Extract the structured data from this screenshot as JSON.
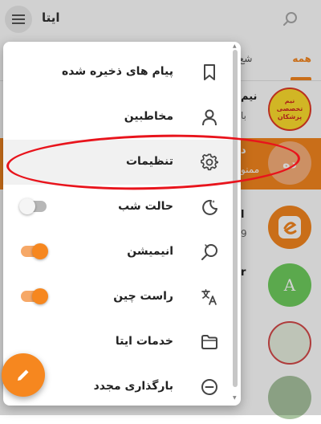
{
  "app": {
    "title": "ایتا"
  },
  "tabs": [
    {
      "label": "همه",
      "active": true
    },
    {
      "label": "شع"
    }
  ],
  "chat_list": [
    {
      "title": "نیم",
      "preview": "با",
      "avatar_text": "نیم تخصصی پزشکان",
      "highlight": false
    },
    {
      "title": "د",
      "preview": "ممنو",
      "avatar_text": "ده",
      "highlight": true
    },
    {
      "title": "ا",
      "preview": "9",
      "avatar_text": "",
      "highlight": false
    },
    {
      "title": "r",
      "preview": "",
      "avatar_text": "A",
      "highlight": false
    }
  ],
  "menu": {
    "items": [
      {
        "label": "پیام های ذخیره شده",
        "icon": "bookmark-icon"
      },
      {
        "label": "مخاطبین",
        "icon": "person-icon"
      },
      {
        "label": "تنظیمات",
        "icon": "gear-icon",
        "active": true
      },
      {
        "label": "حالت شب",
        "icon": "night-mode-icon",
        "toggle": "off"
      },
      {
        "label": "انیمیشن",
        "icon": "animation-icon",
        "toggle": "on"
      },
      {
        "label": "راست چین",
        "icon": "translate-icon",
        "toggle": "on"
      },
      {
        "label": "خدمات ایتا",
        "icon": "folder-icon"
      },
      {
        "label": "بارگذاری مجدد",
        "icon": "reload-icon"
      }
    ]
  },
  "colors": {
    "accent": "#f6871f",
    "annotation": "#e8141c"
  }
}
